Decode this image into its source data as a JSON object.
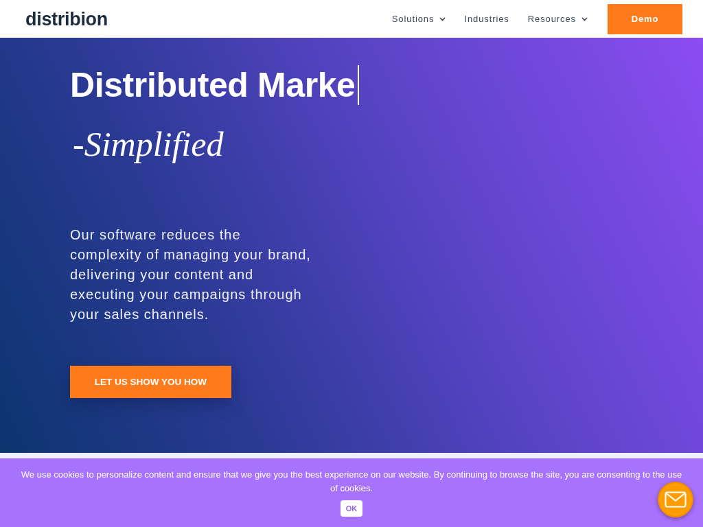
{
  "header": {
    "logo": "distribion",
    "nav": [
      {
        "label": "Solutions",
        "dropdown": true
      },
      {
        "label": "Industries",
        "dropdown": false
      },
      {
        "label": "Resources",
        "dropdown": true
      }
    ],
    "demo_button": "Demo"
  },
  "hero": {
    "headline": "Distributed Marke",
    "typing_cursor": true,
    "tagline": "-Simplified",
    "description": "Our software reduces the complexity of managing your brand, delivering your content and executing your campaigns through your sales channels.",
    "cta_button": "LET US SHOW YOU HOW"
  },
  "cookie_banner": {
    "message": "We use cookies to personalize content and ensure that we give you the best experience on our website. By continuing to browse the site, you are consenting to the use of cookies.",
    "ok_button": "OK"
  }
}
